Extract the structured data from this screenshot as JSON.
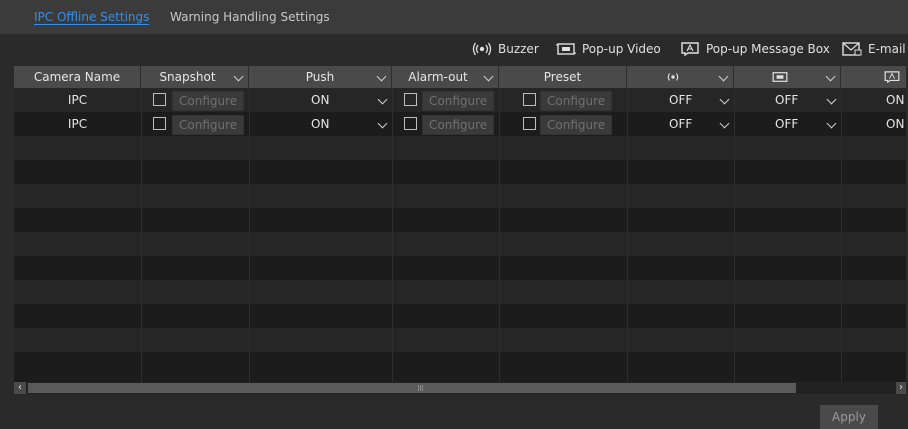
{
  "tabs": [
    {
      "label": "IPC Offline Settings",
      "active": true
    },
    {
      "label": "Warning Handling Settings",
      "active": false
    }
  ],
  "legend": [
    {
      "icon": "buzzer-icon",
      "label": "Buzzer"
    },
    {
      "icon": "popup-video-icon",
      "label": "Pop-up Video"
    },
    {
      "icon": "popup-message-icon",
      "label": "Pop-up Message Box"
    },
    {
      "icon": "email-icon",
      "label": "E-mail"
    }
  ],
  "columns": {
    "camera_name": "Camera Name",
    "snapshot": "Snapshot",
    "push": "Push",
    "alarm_out": "Alarm-out",
    "preset": "Preset"
  },
  "rows": [
    {
      "camera": "IPC",
      "snapshot_btn": "Configure",
      "push": "ON",
      "alarm_btn": "Configure",
      "preset_btn": "Configure",
      "buzzer": "OFF",
      "popup_video": "OFF",
      "popup_msg": "ON"
    },
    {
      "camera": "IPC",
      "snapshot_btn": "Configure",
      "push": "ON",
      "alarm_btn": "Configure",
      "preset_btn": "Configure",
      "buzzer": "OFF",
      "popup_video": "OFF",
      "popup_msg": "ON"
    }
  ],
  "apply_label": "Apply",
  "colors": {
    "accent": "#3a8de0",
    "background": "#2a2a2a",
    "header": "#4a4a4a"
  }
}
